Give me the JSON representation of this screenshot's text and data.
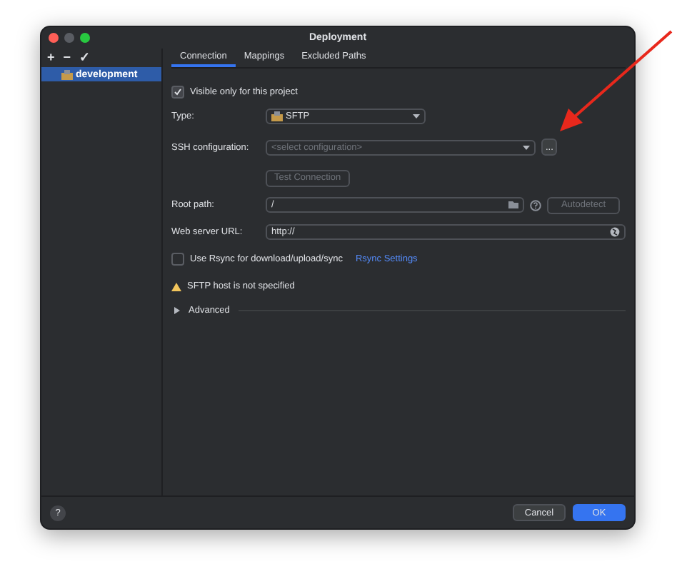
{
  "window": {
    "title": "Deployment"
  },
  "toolbar": {
    "add": "+",
    "remove": "−",
    "apply": "✓"
  },
  "servers": [
    {
      "name": "development",
      "selected": true
    }
  ],
  "tabs": [
    {
      "label": "Connection",
      "selected": true
    },
    {
      "label": "Mappings",
      "selected": false
    },
    {
      "label": "Excluded Paths",
      "selected": false
    }
  ],
  "visible_only": {
    "label": "Visible only for this project",
    "checked": true
  },
  "type": {
    "label": "Type:",
    "value": "SFTP"
  },
  "ssh": {
    "label": "SSH configuration:",
    "placeholder": "<select configuration>",
    "more": "..."
  },
  "test_button": {
    "label": "Test Connection",
    "disabled": true
  },
  "root_path": {
    "label": "Root path:",
    "value": "/",
    "autodetect": "Autodetect"
  },
  "web_url": {
    "label": "Web server URL:",
    "value": "http://"
  },
  "rsync": {
    "label": "Use Rsync for download/upload/sync",
    "checked": false,
    "link": "Rsync Settings"
  },
  "warning": "SFTP host is not specified",
  "advanced": {
    "label": "Advanced",
    "expanded": false
  },
  "footer": {
    "help": "?",
    "cancel": "Cancel",
    "ok": "OK"
  }
}
